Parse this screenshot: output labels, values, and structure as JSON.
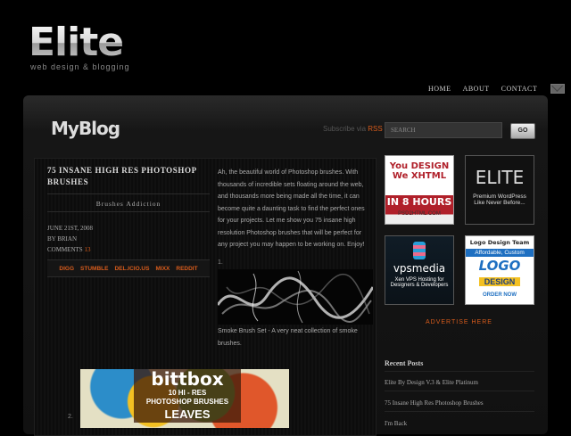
{
  "brand": {
    "title": "Elite",
    "tagline": "web design & blogging"
  },
  "topnav": {
    "items": [
      "HOME",
      "ABOUT",
      "CONTACT"
    ]
  },
  "header": {
    "blog_title": "MyBlog",
    "subscribe_text": "Subscribe via",
    "subscribe_link": "RSS"
  },
  "search": {
    "placeholder": "SEARCH",
    "button_label": "GO"
  },
  "post": {
    "title": "75 INSANE HIGH RES PHOTOSHOP BRUSHES",
    "category": "Brushes Addiction",
    "date": "JUNE 21ST, 2008",
    "author": "BY BRIAN",
    "comments_label": "COMMENTS",
    "comments_count": "13",
    "social": [
      "DIGG",
      "STUMBLE",
      "DEL.ICIO.US",
      "MIXX",
      "REDDIT"
    ],
    "intro": "Ah, the beautiful world of Photoshop brushes. With thousands of incredible sets floating around the web, and thousands more being made all the time, it can become quite a daunting task to find the perfect ones for your projects. Let me show you 75 insane high resolution Photoshop brushes that will be perfect for any project you may happen to be working on. Enjoy!",
    "list": [
      {
        "num": "1.",
        "caption": "Smoke Brush Set - A very neat collection of smoke brushes."
      },
      {
        "num": "2.",
        "image_title": "bittbox",
        "image_line1": "10 HI - RES",
        "image_line2": "PHOTOSHOP BRUSHES",
        "image_line3": "LEAVES"
      }
    ]
  },
  "ads": {
    "ad1": {
      "line1": "You DESIGN",
      "line2": "We XHTML",
      "line3": "IN 8 HOURS",
      "line4": "PSD2HTML.COM"
    },
    "ad2": {
      "line1": "ELITE",
      "line2": "Premium WordPress",
      "line3": "Like Never Before..."
    },
    "ad3": {
      "line1": "vpsmedia",
      "line2": "Xen VPS Hosting for",
      "line3": "Designers & Developers"
    },
    "ad4": {
      "line1": "Logo Design Team",
      "line2": "Affordable, Custom",
      "line3": "LOGO",
      "line4": "DESIGN",
      "line5": "ORDER NOW"
    },
    "advertise_label": "ADVERTISE HERE"
  },
  "sidebar": {
    "recent_title": "Recent Posts",
    "recent_posts": [
      "Elite By Design V.3 & Elite Platinum",
      "75 Insane High Res Photoshop Brushes",
      "I'm Back"
    ]
  },
  "colors": {
    "accent": "#d85c1c",
    "background": "#000000"
  }
}
